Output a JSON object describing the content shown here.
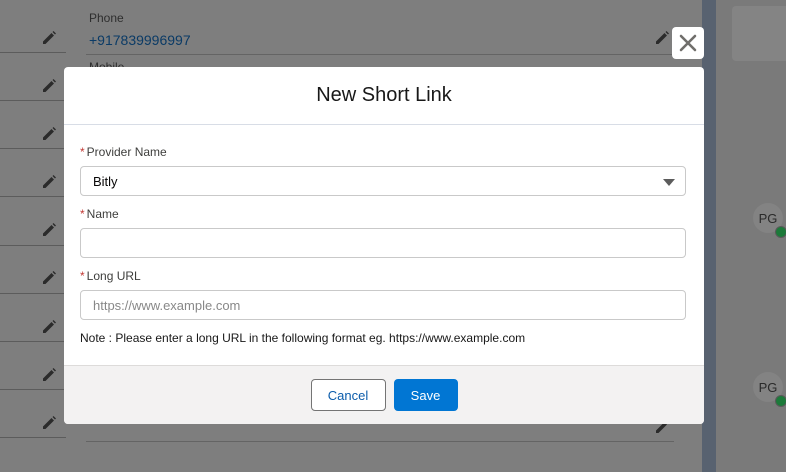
{
  "background": {
    "phone_label": "Phone",
    "phone_value": "+917839996997",
    "mobile_label": "Mobile",
    "avatars": [
      "PG",
      "PG"
    ]
  },
  "modal": {
    "title": "New Short Link",
    "close_icon": "close-icon",
    "fields": {
      "provider": {
        "required_mark": "*",
        "label": "Provider Name",
        "value": "Bitly"
      },
      "name": {
        "required_mark": "*",
        "label": "Name",
        "value": ""
      },
      "long_url": {
        "required_mark": "*",
        "label": "Long URL",
        "value": "",
        "placeholder": "https://www.example.com"
      }
    },
    "note": "Note : Please enter a long URL in the following format eg. https://www.example.com",
    "footer": {
      "cancel_label": "Cancel",
      "save_label": "Save"
    }
  },
  "colors": {
    "brand": "#0176d3",
    "required": "#c23934",
    "link": "#0b5cab"
  }
}
